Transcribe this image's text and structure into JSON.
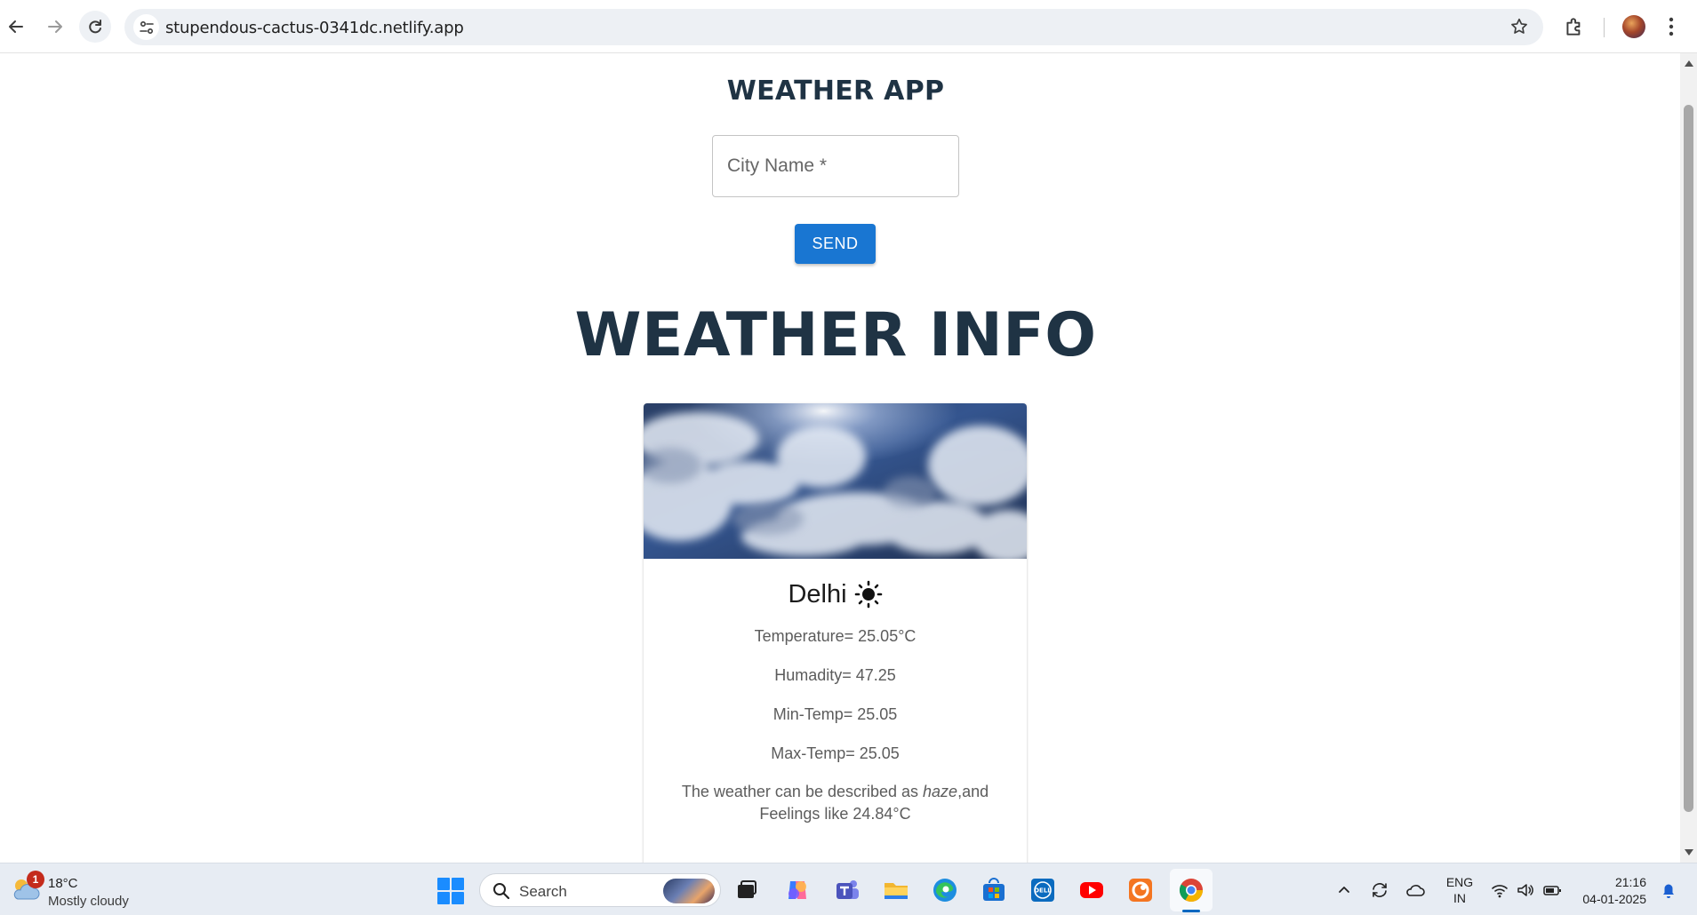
{
  "browser": {
    "url": "stupendous-cactus-0341dc.netlify.app"
  },
  "page": {
    "app_title": "WEATHER APP",
    "city_input": {
      "placeholder": "City Name *",
      "value": ""
    },
    "send_label": "SEND",
    "info_title": "WEATHER INFO"
  },
  "card": {
    "city": "Delhi",
    "weather_icon": "sun-icon",
    "temperature": "Temperature= 25.05°C",
    "humidity": "Humadity= 47.25",
    "min_temp": "Min-Temp= 25.05",
    "max_temp": "Max-Temp= 25.05",
    "description_prefix": "The weather can be described as ",
    "description_condition": "haze",
    "description_suffix": ",and Feelings like 24.84°C"
  },
  "taskbar": {
    "weather": {
      "badge": "1",
      "temp": "18°C",
      "condition": "Mostly cloudy"
    },
    "search_label": "Search",
    "language": {
      "line1": "ENG",
      "line2": "IN"
    },
    "clock": {
      "time": "21:16",
      "date": "04-01-2025"
    }
  },
  "colors": {
    "heading": "#1f3344",
    "button": "#1976d2",
    "text_secondary": "#5c5c5c"
  }
}
